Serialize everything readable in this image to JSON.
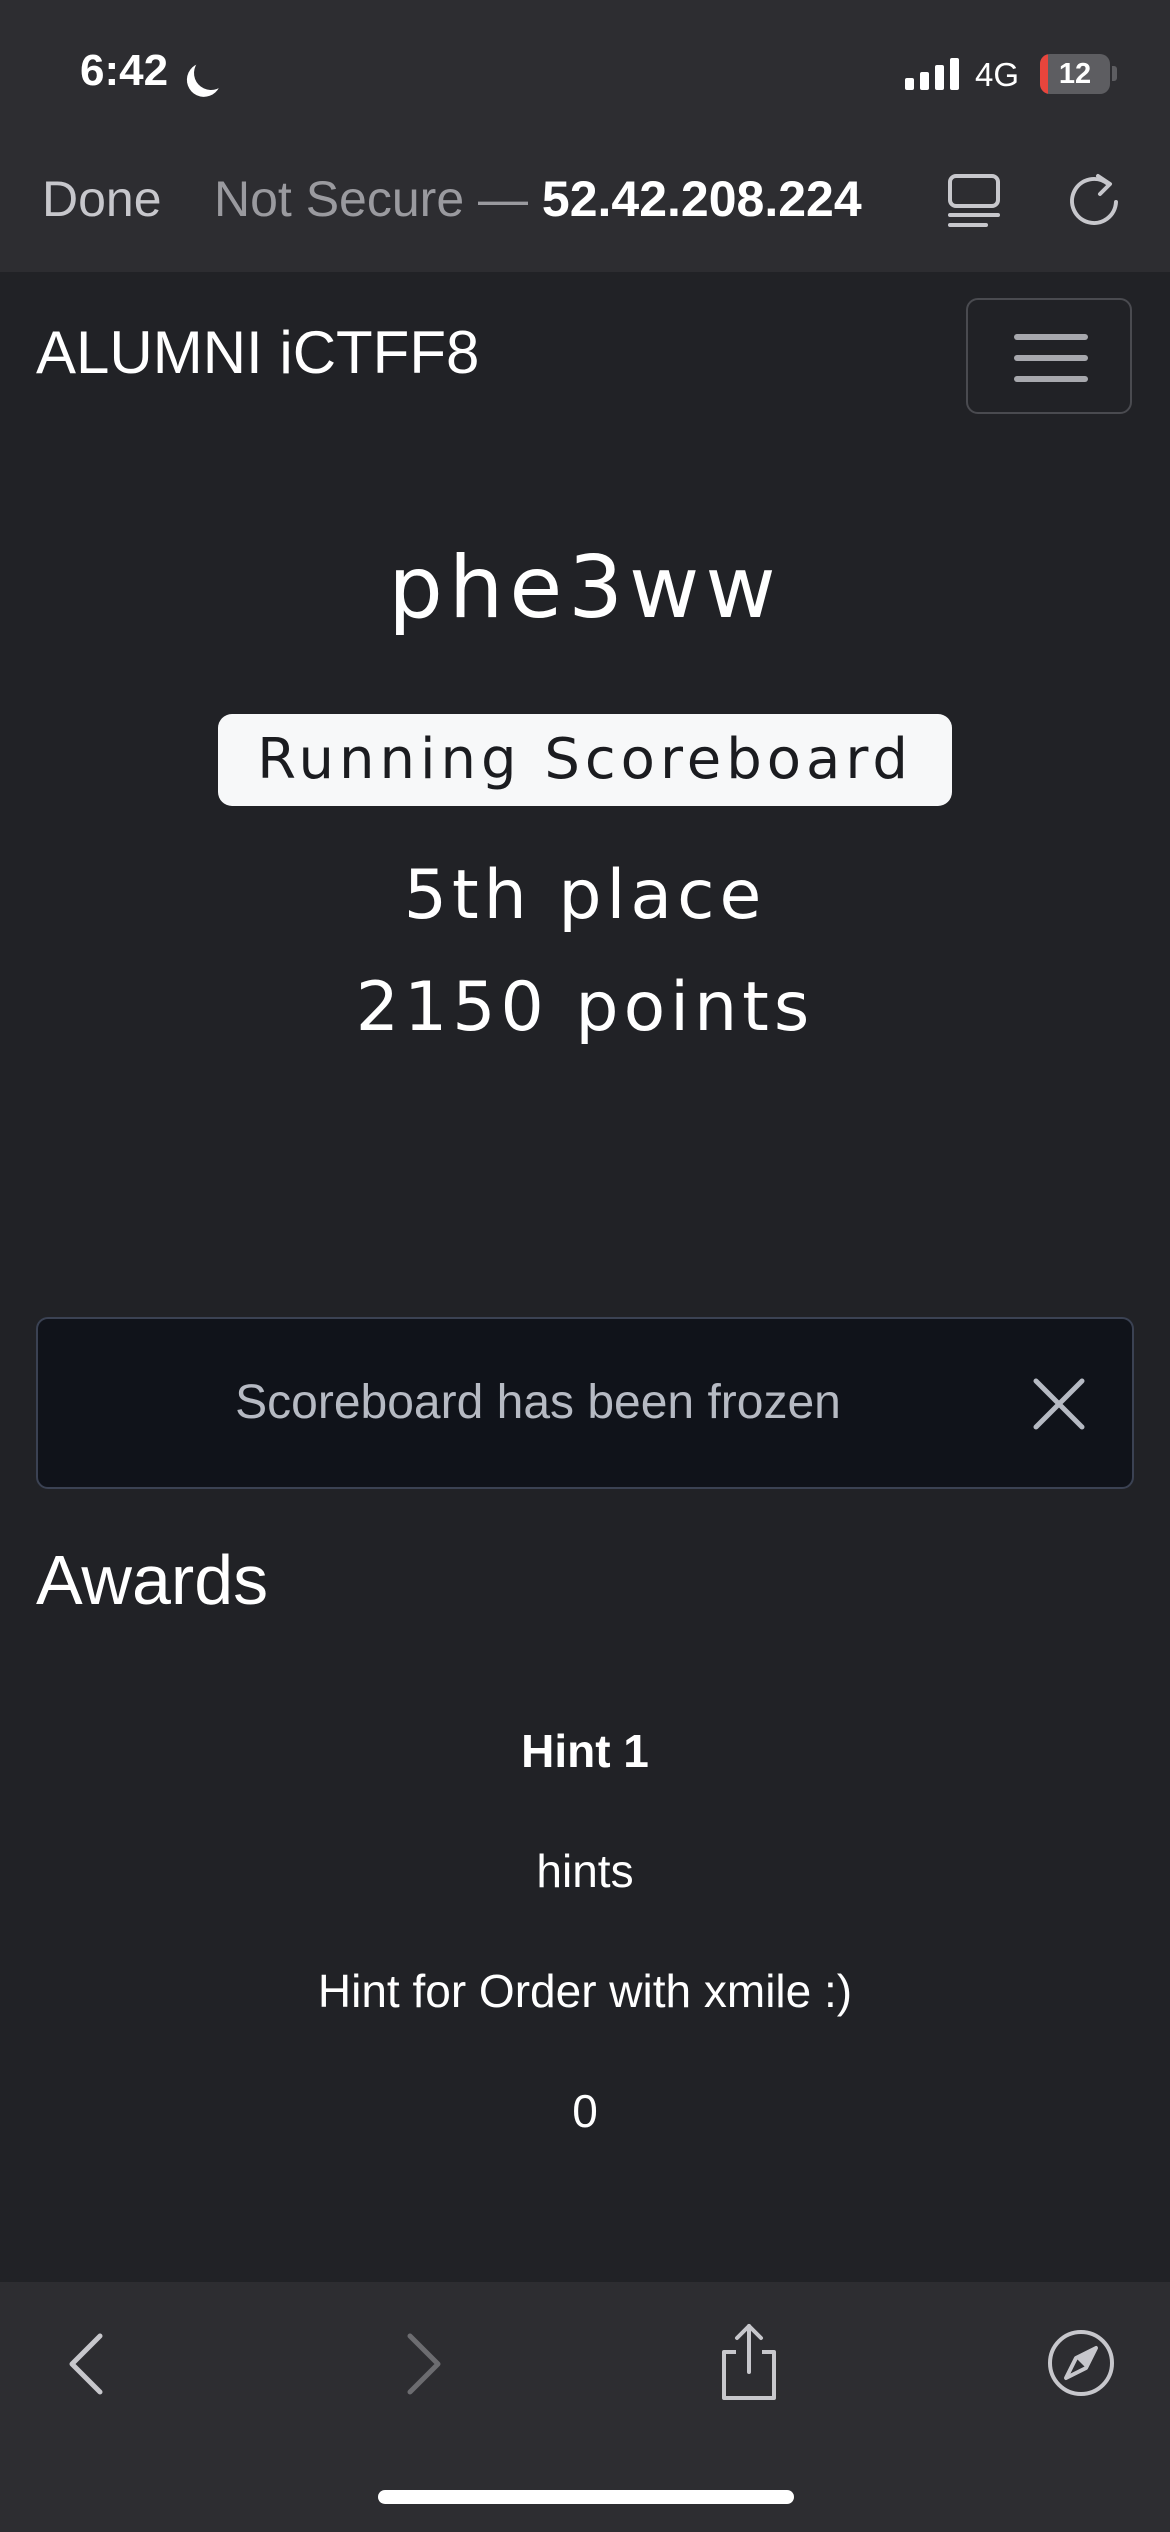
{
  "status_bar": {
    "time": "6:42",
    "network": "4G",
    "battery_level": "12",
    "battery_fraction": 0.12,
    "icons": [
      "moon-icon",
      "signal-icon",
      "battery-icon"
    ]
  },
  "browser": {
    "done_label": "Done",
    "not_secure_label": "Not Secure —",
    "host": "52.42.208.224",
    "icons": [
      "reader-icon",
      "reload-icon"
    ]
  },
  "navbar": {
    "brand": "ALUMNI iCTFF8",
    "menu_icon": "hamburger-icon"
  },
  "team": {
    "name": "phe3ww",
    "scoreboard_button": "Running Scoreboard",
    "place": "5th place",
    "points": "2150 points"
  },
  "alert": {
    "message": "Scoreboard has been frozen",
    "close_icon": "close-icon"
  },
  "awards": {
    "title": "Awards",
    "items": [
      {
        "name": "Hint 1",
        "category": "hints",
        "description": "Hint for Order with xmile :)",
        "value": "0"
      }
    ]
  },
  "toolbar": {
    "icons": [
      "back-icon",
      "forward-icon",
      "share-icon",
      "compass-icon"
    ]
  },
  "colors": {
    "page_bg": "#212226",
    "chrome_bg": "#2d2d31",
    "alert_bg": "#10131a",
    "battery_low": "#e8453c"
  }
}
